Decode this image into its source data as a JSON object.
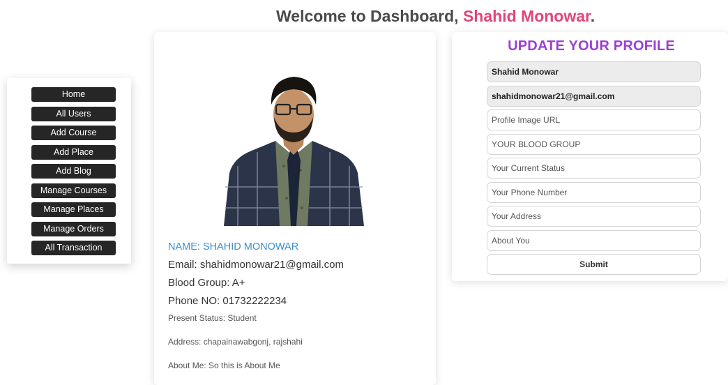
{
  "header": {
    "prefix": "Welcome to Dashboard,",
    "user_name": "Shahid Monowar",
    "suffix": "."
  },
  "sidebar": {
    "items": [
      {
        "label": "Home"
      },
      {
        "label": "All Users"
      },
      {
        "label": "Add Course"
      },
      {
        "label": "Add Place"
      },
      {
        "label": "Add Blog"
      },
      {
        "label": "Manage Courses"
      },
      {
        "label": "Manage Places"
      },
      {
        "label": "Manage Orders"
      },
      {
        "label": "All Transaction"
      }
    ]
  },
  "profile": {
    "name": "NAME: SHAHID MONOWAR",
    "email": "Email: shahidmonowar21@gmail.com",
    "blood_group": "Blood Group: A+",
    "phone": "Phone NO: 01732222234",
    "status": "Present Status: Student",
    "address": "Address: chapainawabgonj, rajshahi",
    "about": "About Me: So this is About Me"
  },
  "update_form": {
    "title": "UPDATE YOUR PROFILE",
    "name_value": "Shahid Monowar",
    "email_value": "shahidmonowar21@gmail.com",
    "image_placeholder": "Profile Image URL",
    "blood_placeholder": "YOUR BLOOD GROUP",
    "status_placeholder": "Your Current Status",
    "phone_placeholder": "Your Phone Number",
    "address_placeholder": "Your Address",
    "about_placeholder": "About You",
    "submit_label": "Submit"
  },
  "colors": {
    "accent_pink": "#e2457a",
    "title_purple": "#9b3fd6",
    "name_blue": "#3d8ec9",
    "sidebar_button": "#262626"
  }
}
